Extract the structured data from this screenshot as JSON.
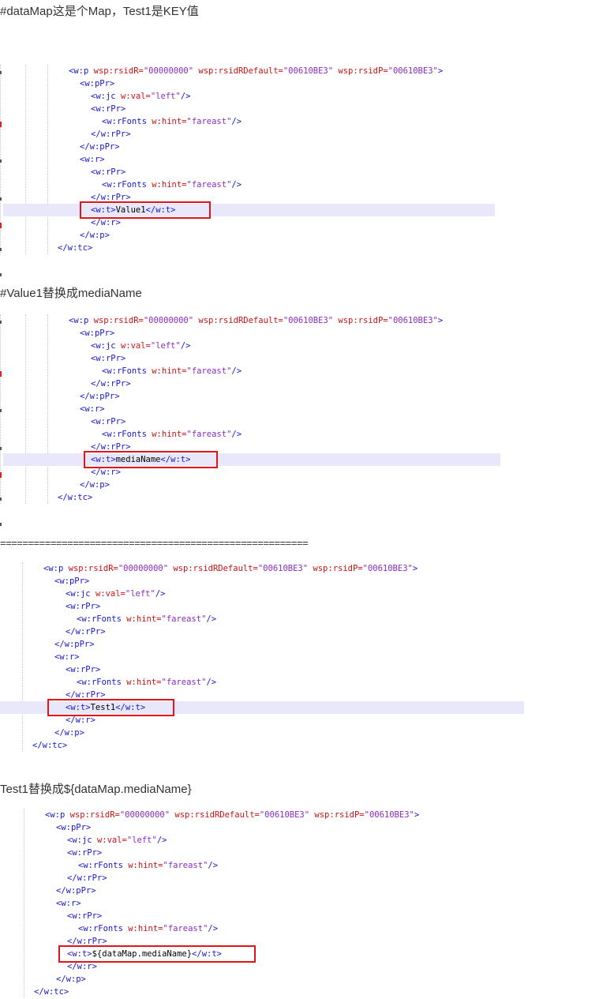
{
  "headings": {
    "h1": "#dataMap这是个Map，Test1是KEY值",
    "h2": "#Value1替换成mediaName",
    "separator": "=======================================================",
    "h4": "Test1替换成${dataMap.mediaName}"
  },
  "xml": {
    "p_open": "<w:p",
    "attr_rsidR": "wsp:rsidR=",
    "val_rsidR": "\"00000000\"",
    "attr_rsidRDefault": "wsp:rsidRDefault=",
    "val_rsidRDefault": "\"00610BE3\"",
    "attr_rsidP": "wsp:rsidP=",
    "val_rsidP": "\"00610BE3\"",
    "close_angle": ">",
    "pPr_open": "<w:pPr>",
    "jc_open": "<w:jc",
    "attr_val": "w:val=",
    "val_left": "\"left\"",
    "self_close": "/>",
    "rPr_open": "<w:rPr>",
    "rFonts_open": "<w:rFonts",
    "attr_hint": "w:hint=",
    "val_fareast": "\"fareast\"",
    "rPr_close": "</w:rPr>",
    "pPr_close": "</w:pPr>",
    "r_open": "<w:r>",
    "t_open": "<w:t>",
    "t_close": "</w:t>",
    "r_close": "</w:r>",
    "p_close": "</w:p>",
    "tc_close": "</w:tc>"
  },
  "blocks": [
    {
      "text_value": "Value1"
    },
    {
      "text_value": "mediaName"
    },
    {
      "text_value": "Test1"
    },
    {
      "text_value": "${dataMap.mediaName}"
    }
  ]
}
